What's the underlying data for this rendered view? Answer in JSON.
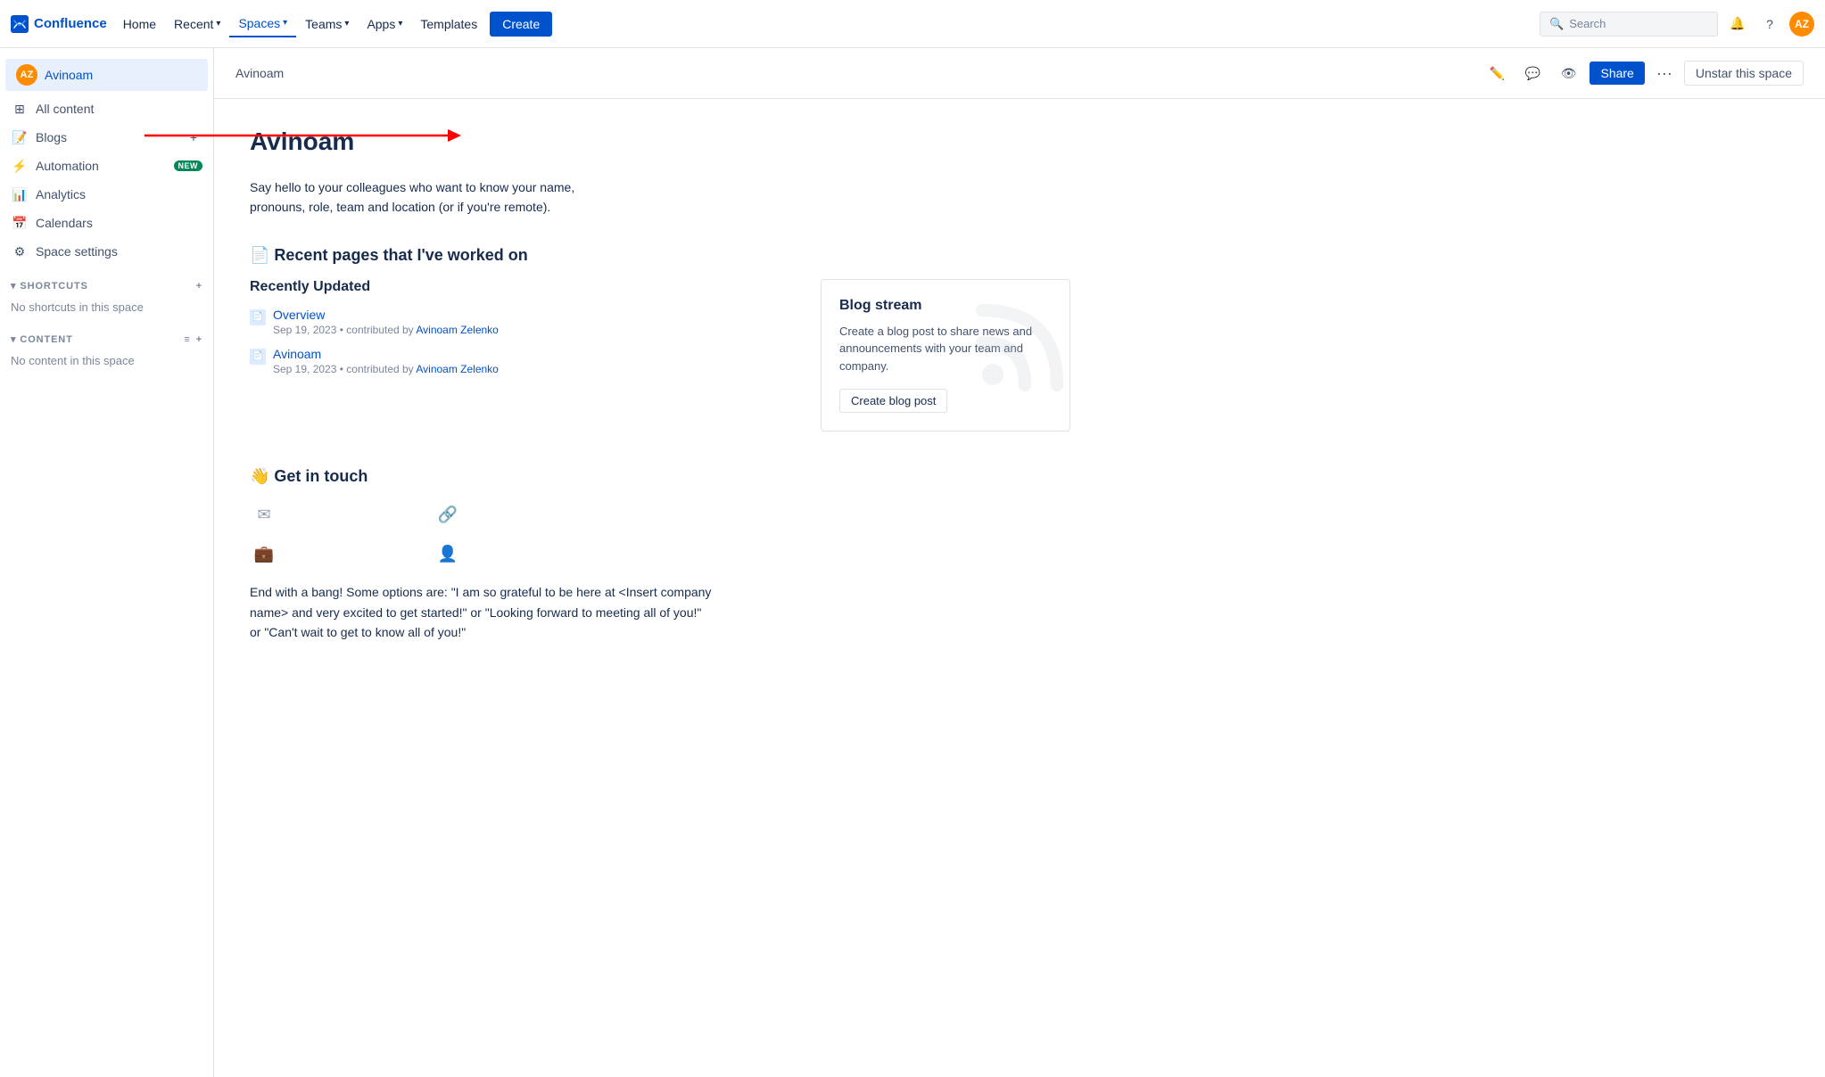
{
  "topnav": {
    "brand": "Confluence",
    "links": [
      {
        "label": "Home",
        "id": "home",
        "active": false,
        "hasChevron": false
      },
      {
        "label": "Recent",
        "id": "recent",
        "active": false,
        "hasChevron": true
      },
      {
        "label": "Spaces",
        "id": "spaces",
        "active": true,
        "hasChevron": true
      },
      {
        "label": "Teams",
        "id": "teams",
        "active": false,
        "hasChevron": true
      },
      {
        "label": "Apps",
        "id": "apps",
        "active": false,
        "hasChevron": true
      },
      {
        "label": "Templates",
        "id": "templates",
        "active": false,
        "hasChevron": false
      }
    ],
    "create_label": "Create",
    "search_placeholder": "Search",
    "avatar_initials": "AZ"
  },
  "sidebar": {
    "user_name": "Avinoam",
    "user_initials": "AZ",
    "items": [
      {
        "id": "all-content",
        "label": "All content",
        "icon": "grid"
      },
      {
        "id": "blogs",
        "label": "Blogs",
        "icon": "blog",
        "has_add": true
      },
      {
        "id": "automation",
        "label": "Automation",
        "icon": "bolt",
        "is_new": true
      },
      {
        "id": "analytics",
        "label": "Analytics",
        "icon": "chart"
      },
      {
        "id": "calendars",
        "label": "Calendars",
        "icon": "calendar"
      },
      {
        "id": "space-settings",
        "label": "Space settings",
        "icon": "gear"
      }
    ],
    "shortcuts_label": "SHORTCUTS",
    "shortcuts_empty": "No shortcuts in this space",
    "content_label": "CONTENT",
    "content_empty": "No content in this space"
  },
  "breadcrumb": {
    "label": "Avinoam"
  },
  "actions": {
    "share_label": "Share",
    "unstar_label": "Unstar this space",
    "more_icon": "···"
  },
  "main": {
    "page_title": "Avinoam",
    "intro_text": "Say hello to your colleagues who want to know your name, pronouns, role, team and location (or if you're remote).",
    "recent_section_title": "📄 Recent pages that I've worked on",
    "recently_updated_label": "Recently Updated",
    "pages": [
      {
        "title": "Overview",
        "date": "Sep 19, 2023",
        "contributed_by": "contributed by",
        "author": "Avinoam Zelenko",
        "icon": "page"
      },
      {
        "title": "Avinoam",
        "date": "Sep 19, 2023",
        "contributed_by": "contributed by",
        "author": "Avinoam Zelenko",
        "icon": "page"
      }
    ],
    "blog_stream": {
      "title": "Blog stream",
      "text": "Create a blog post to share news and announcements with your team and company.",
      "button_label": "Create blog post"
    },
    "get_in_touch_title": "👋 Get in touch",
    "end_text": "End with a bang! Some options are: \"I am so grateful to be here at <Insert company name> and very excited to get started!\" or \"Looking forward to meeting all of you!\" or \"Can't wait to get to know all of you!\""
  },
  "red_arrow": {
    "visible": true
  }
}
